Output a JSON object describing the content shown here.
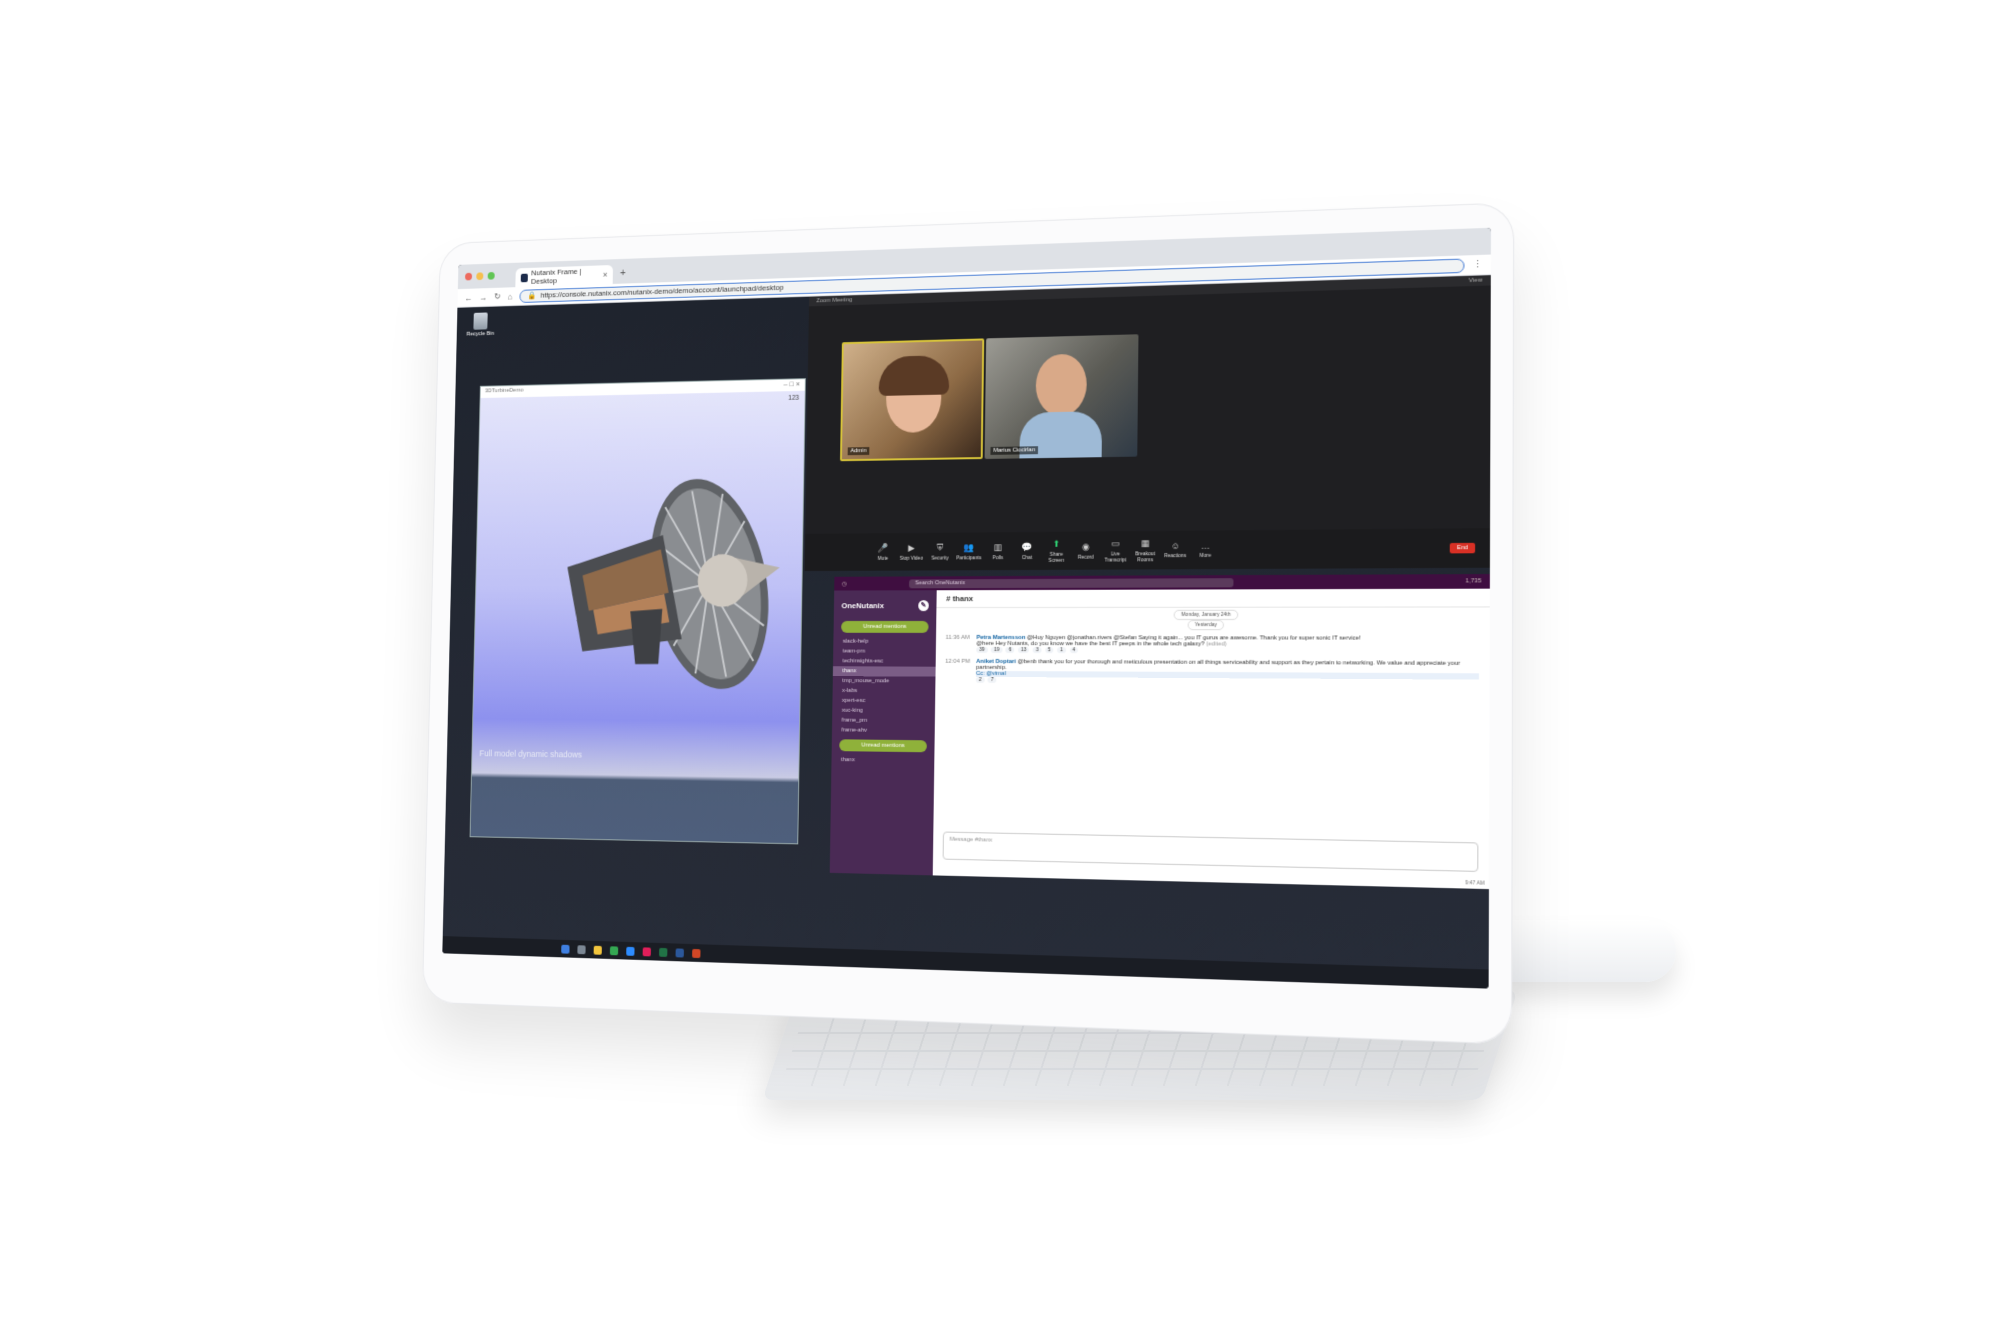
{
  "browser": {
    "tab_title": "Nutanix Frame | Desktop",
    "tab_close": "×",
    "new_tab": "+",
    "url": "https://console.nutanix.com/nutanix-demo/demo/account/launchpad/desktop"
  },
  "desktop": {
    "recycle_bin_label": "Recycle Bin"
  },
  "cad": {
    "window_title": "3DTurbineDemo",
    "fps": "123",
    "caption": "Full model dynamic shadows"
  },
  "zoom": {
    "window_title": "Zoom Meeting",
    "view_button": "View",
    "participants": [
      {
        "name": "Admin"
      },
      {
        "name": "Marius Ciocirlan"
      }
    ],
    "toolbar": [
      {
        "label": "Mute",
        "icon": "microphone-icon"
      },
      {
        "label": "Stop Video",
        "icon": "video-camera-icon"
      },
      {
        "label": "Security",
        "icon": "shield-icon"
      },
      {
        "label": "Participants",
        "icon": "people-icon"
      },
      {
        "label": "Polls",
        "icon": "bar-chart-icon"
      },
      {
        "label": "Chat",
        "icon": "chat-bubble-icon"
      },
      {
        "label": "Share Screen",
        "icon": "share-screen-icon"
      },
      {
        "label": "Record",
        "icon": "record-icon"
      },
      {
        "label": "Live Transcript",
        "icon": "cc-icon"
      },
      {
        "label": "Breakout Rooms",
        "icon": "grid-icon"
      },
      {
        "label": "Reactions",
        "icon": "smile-icon"
      },
      {
        "label": "More",
        "icon": "ellipsis-icon"
      }
    ],
    "end_button": "End"
  },
  "slack": {
    "search_placeholder": "Search OneNutanix",
    "member_count": "1,735",
    "workspace": "OneNutanix",
    "unread_mentions": "Unread mentions",
    "channels": [
      "slack-help",
      "team-pm",
      "techinsights-esc",
      "thanx",
      "tmp_mouse_mode",
      "x-labs",
      "xpert-esc",
      "xuc-king",
      "frame_pm",
      "frame-ahv"
    ],
    "active_channel": "thanx",
    "footer_channel": "thanx",
    "channel_header": "# thanx",
    "day_dividers": [
      "Monday, January 24th",
      "Yesterday"
    ],
    "messages": [
      {
        "time": "11:36 AM",
        "author": "Petra Martensson",
        "text_a": "@Huy Nguyen @jonathan.rivers @Stefan Saying it again... you IT gurus are awesome. Thank you for super sonic IT service!",
        "text_b": "@here Hey Nutants, do you know we have the best IT peeps in the whole tech galaxy?",
        "edited": "(edited)"
      },
      {
        "time": "12:04 PM",
        "author": "Aniket Doptari",
        "text_a": "@benb thank you for your thorough and meticulous presentation on all things serviceability and support as they pertain to networking. We value and appreciate your partnership.",
        "text_b": "Cc: @vimal"
      }
    ],
    "reactions": [
      "39",
      "19",
      "6",
      "13",
      "3",
      "5",
      "1",
      "4",
      "2",
      "7"
    ],
    "composer_placeholder": "Message #thanx",
    "clock": "9:47 AM"
  },
  "colors": {
    "slack_sidebar": "#4a2a55",
    "slack_topbar": "#3f0e40",
    "zoom_end": "#d93025",
    "unread_pill": "#8fb13a",
    "url_focus": "#4a7fd6"
  }
}
